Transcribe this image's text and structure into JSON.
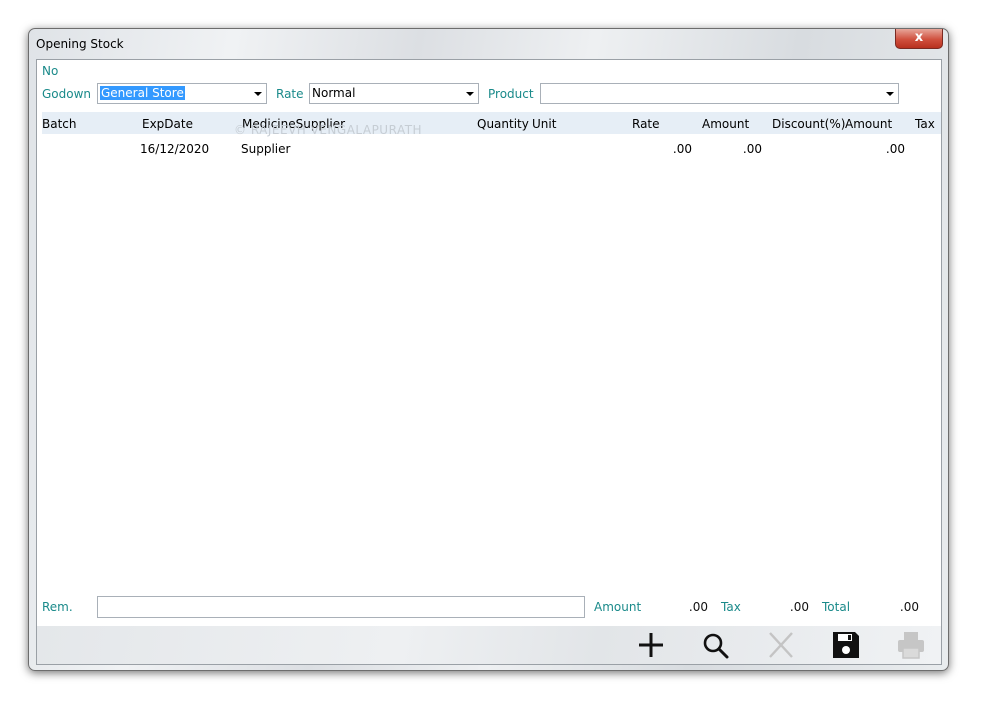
{
  "window": {
    "title": "Opening Stock",
    "close_glyph": "x"
  },
  "form": {
    "no_label": "No",
    "godown_label": "Godown",
    "godown_value": "General Store",
    "rate_label": "Rate",
    "rate_value": "Normal",
    "product_label": "Product",
    "product_value": ""
  },
  "grid": {
    "watermark": "© RAJEEVH VENGALAPURATH",
    "columns": [
      "Batch",
      "ExpDate",
      "MedicineSupplier",
      "Quantity",
      "Unit",
      "Rate",
      "Amount",
      "Discount(%)",
      "Amount",
      "Tax"
    ],
    "rows": [
      {
        "batch": "",
        "exp_date": "16/12/2020",
        "supplier": "Supplier",
        "quantity": "",
        "unit": "",
        "rate": ".00",
        "amount": ".00",
        "discount": "",
        "net_amount": ".00",
        "tax": ""
      }
    ]
  },
  "footer": {
    "rem_label": "Rem.",
    "rem_value": "",
    "amount_label": "Amount",
    "amount_value": ".00",
    "tax_label": "Tax",
    "tax_value": ".00",
    "total_label": "Total",
    "total_value": ".00"
  },
  "toolbar": {
    "buttons": [
      {
        "icon": "plus-icon",
        "enabled": true
      },
      {
        "icon": "search-icon",
        "enabled": true
      },
      {
        "icon": "close-icon",
        "enabled": false
      },
      {
        "icon": "save-icon",
        "enabled": true
      },
      {
        "icon": "print-icon",
        "enabled": false
      }
    ]
  }
}
